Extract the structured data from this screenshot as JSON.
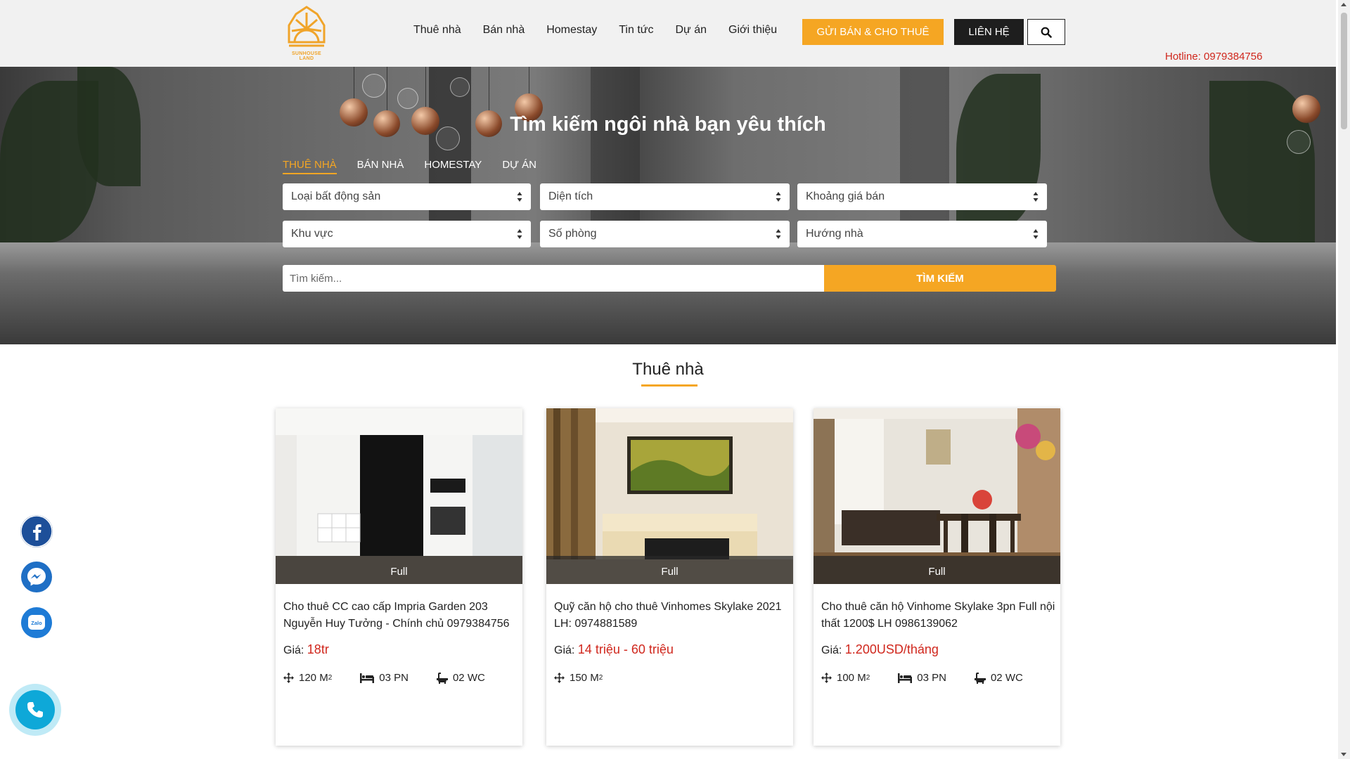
{
  "brand": {
    "logo_text": "SUNHOUSE LAND",
    "accent": "#f5a623",
    "price_color": "#d0271d"
  },
  "nav": {
    "items": [
      "Thuê nhà",
      "Bán nhà",
      "Homestay",
      "Tin tức",
      "Dự án",
      "Giới thiệu"
    ],
    "send_button": "GỬI BÁN & CHO THUÊ",
    "contact_button": "LIÊN HỆ",
    "search_icon": "search-icon",
    "hotline": "Hotline: 0979384756"
  },
  "hero": {
    "title": "Tìm kiếm ngôi nhà bạn yêu thích",
    "tabs": [
      "THUÊ NHÀ",
      "BÁN NHÀ",
      "HOMESTAY",
      "DỰ ÁN"
    ],
    "active_tab": "THUÊ NHÀ",
    "selects": [
      "Loại bất động sản",
      "Diện tích",
      "Khoảng giá bán",
      "Khu vực",
      "Số phòng",
      "Hướng nhà"
    ],
    "search_placeholder": "Tìm kiếm...",
    "search_button": "TÌM KIẾM"
  },
  "section": {
    "title": "Thuê nhà"
  },
  "listings": [
    {
      "badge": "Full",
      "title": "Cho thuê CC cao cấp Impria Garden 203 Nguyễn Huy Tưởng - Chính chủ 0979384756",
      "price_label": "Giá:",
      "price": "18tr",
      "area": "120 M",
      "bedrooms": "03 PN",
      "bathrooms": "02 WC"
    },
    {
      "badge": "Full",
      "title": "Quỹ căn hộ cho thuê Vinhomes Skylake 2021 LH: 0974881589",
      "price_label": "Giá:",
      "price": "14 triệu - 60 triệu",
      "area": "150 M"
    },
    {
      "badge": "Full",
      "title": "Cho thuê căn hộ Vinhome Skylake 3pn Full nội thất 1200$ LH 0986139062",
      "price_label": "Giá:",
      "price": "1.200USD/tháng",
      "area": "100 M",
      "bedrooms": "03 PN",
      "bathrooms": "02 WC"
    }
  ],
  "area_superscript": "2",
  "floating": {
    "icons": [
      "facebook-icon",
      "messenger-icon",
      "zalo-icon",
      "phone-icon"
    ],
    "zalo_label": "Zalo"
  }
}
